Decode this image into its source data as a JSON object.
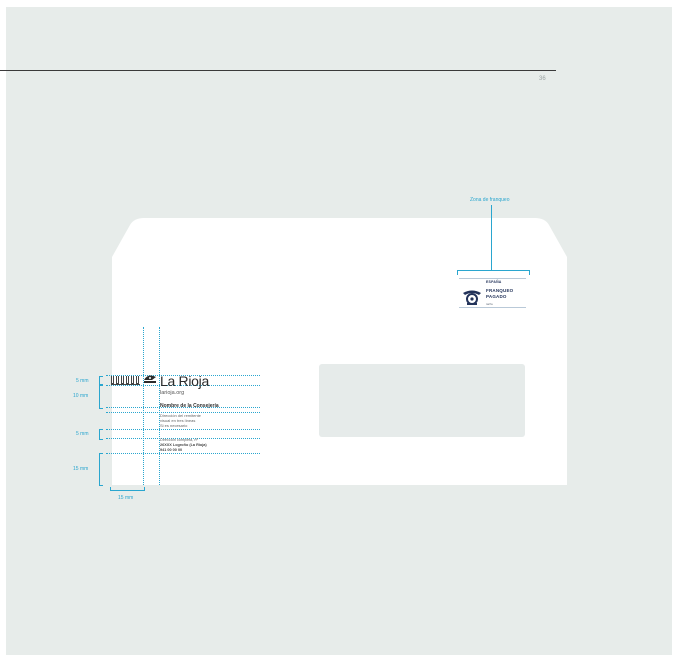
{
  "page_number": "36",
  "stamp_zone_label": "Zona de franqueo",
  "stamp": {
    "country": "ESPAÑA",
    "line1": "FRANQUEO",
    "line2": "PAGADO",
    "note": "tarifa"
  },
  "logo": {
    "name": "La Rioja",
    "web": "larioja.org"
  },
  "sender": {
    "department": "Nombre de la Consejería",
    "lines": [
      "Dirección del remitente",
      "visual en tres líneas",
      "Si es necesario"
    ],
    "address": [
      "Dirección completa, nº",
      "26XXX Logroño (La Rioja)",
      "941 00 00 00"
    ]
  },
  "measures": {
    "m5a": "5 mm",
    "m10": "10 mm",
    "m5b": "5 mm",
    "m15": "15 mm",
    "m15h": "15 mm"
  },
  "colors": {
    "guide": "#2aa6cf",
    "page": "#e7ecea",
    "envelope": "#ffffff"
  }
}
